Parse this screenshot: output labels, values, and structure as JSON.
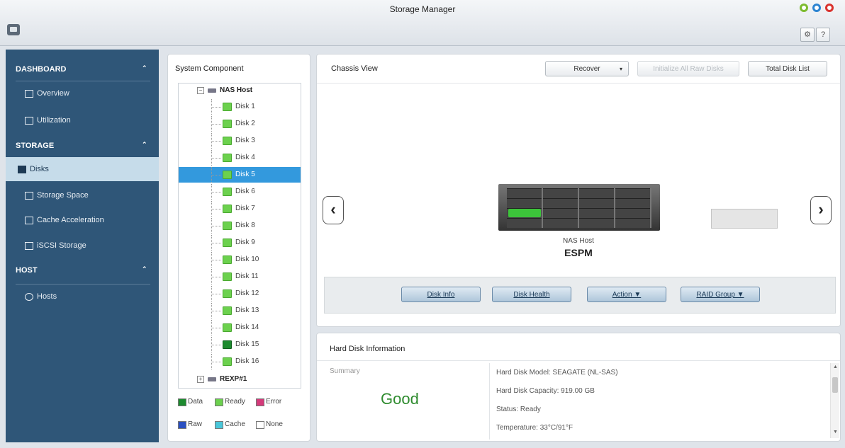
{
  "window": {
    "title": "Storage Manager"
  },
  "toolbar": {
    "gear": "⚙",
    "help": "?"
  },
  "sidebar": {
    "sections": [
      {
        "label": "DASHBOARD",
        "items": [
          "Overview",
          "Utilization"
        ]
      },
      {
        "label": "STORAGE",
        "items": [
          "Disks",
          "Storage Space",
          "Cache Acceleration",
          "iSCSI Storage"
        ]
      },
      {
        "label": "HOST",
        "items": [
          "Hosts"
        ]
      }
    ],
    "active_item": "Disks"
  },
  "system_component": {
    "title": "System Component",
    "host": "NAS Host",
    "disks": [
      "Disk 1",
      "Disk 2",
      "Disk 3",
      "Disk 4",
      "Disk 5",
      "Disk 6",
      "Disk 7",
      "Disk 8",
      "Disk 9",
      "Disk 10",
      "Disk 11",
      "Disk 12",
      "Disk 13",
      "Disk 14",
      "Disk 15",
      "Disk 16"
    ],
    "selected_disk": "Disk 5",
    "expansion": "REXP#1",
    "legend": [
      {
        "label": "Data",
        "color": "#1d8a2f"
      },
      {
        "label": "Ready",
        "color": "#6cd14e"
      },
      {
        "label": "Error",
        "color": "#d43a7a"
      },
      {
        "label": "Raw",
        "color": "#2a4fc0"
      },
      {
        "label": "Cache",
        "color": "#49c6d9"
      },
      {
        "label": "None",
        "color": "#ffffff"
      }
    ]
  },
  "chassis": {
    "title": "Chassis View",
    "buttons": {
      "recover": "Recover",
      "initialize": "Initialize All Raw Disks",
      "total_disk_list": "Total Disk List"
    },
    "host_label": "NAS Host",
    "host_model": "ESPM",
    "actions": {
      "disk_info": "Disk Info",
      "disk_health": "Disk Health",
      "action": "Action ▼",
      "raid_group": "RAID Group ▼"
    }
  },
  "hard_disk_info": {
    "title": "Hard Disk Information",
    "summary_label": "Summary",
    "summary_value": "Good",
    "lines": [
      "Hard Disk Model: SEAGATE (NL-SAS)",
      "Hard Disk Capacity: 919.00 GB",
      "Status: Ready",
      "Temperature: 33°C/91°F"
    ]
  },
  "colors": {
    "sidebar_bg": "#2f5678",
    "sidebar_active": "#c6dcea",
    "selection": "#3399dd",
    "good": "#2e8b2e"
  }
}
